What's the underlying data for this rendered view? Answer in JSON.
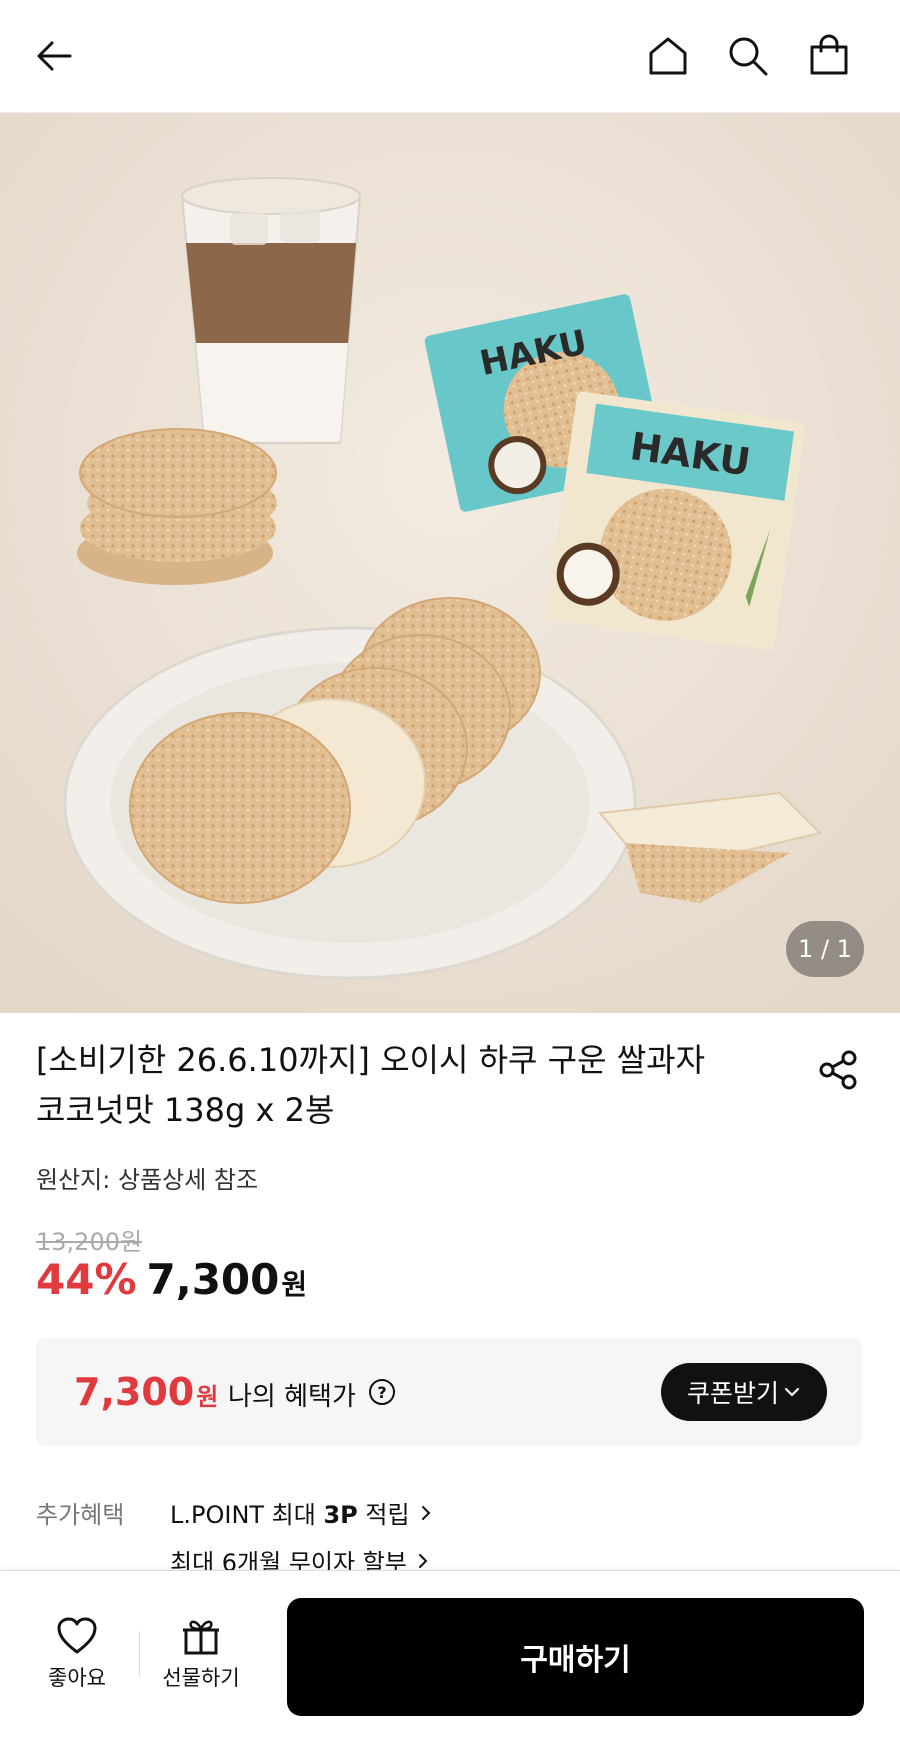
{
  "header": {
    "back_icon": "arrow-left-icon",
    "home_icon": "home-icon",
    "search_icon": "search-icon",
    "cart_icon": "shopping-bag-icon"
  },
  "gallery": {
    "counter": "1 / 1",
    "package_brand": "HAKU"
  },
  "product": {
    "title_line1": "[소비기한 26.6.10까지] 오이시 하쿠 구운 쌀과자",
    "title_line2": "코코넛맛 138g x 2봉",
    "origin": "원산지: 상품상세 참조",
    "original_price": "13,200원",
    "discount": "44%",
    "price": "7,300",
    "price_unit": "원",
    "share_icon": "share-icon"
  },
  "benefit": {
    "price": "7,300",
    "price_unit": "원",
    "label": "나의 혜택가",
    "help_icon": "question-circle-icon",
    "coupon_label": "쿠폰받기"
  },
  "extra": {
    "label": "추가혜택",
    "line1_prefix": "L.POINT 최대 ",
    "line1_bold": "3P",
    "line1_suffix": " 적립",
    "line2": "최대 6개월 무이자 할부"
  },
  "bottom_bar": {
    "like_label": "좋아요",
    "gift_label": "선물하기",
    "buy_label": "구매하기"
  },
  "colors": {
    "accent_red": "#e0393e",
    "primary_black": "#000000"
  }
}
